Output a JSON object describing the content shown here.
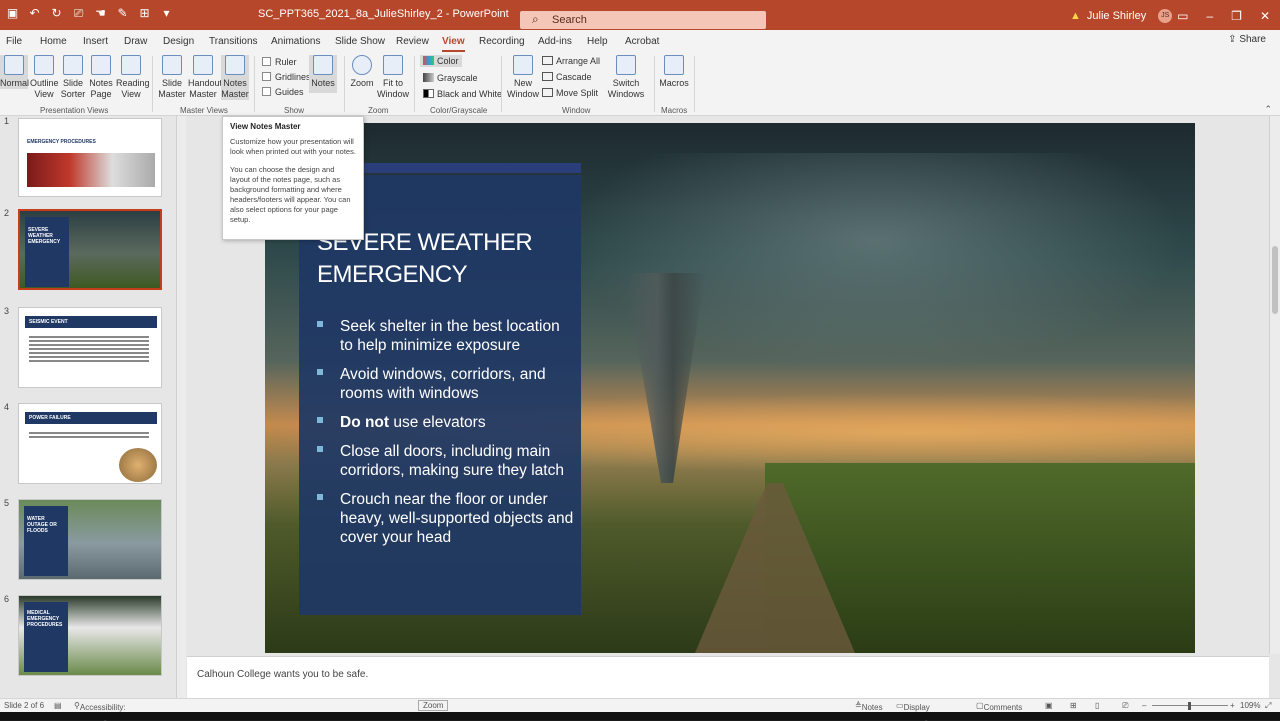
{
  "app": {
    "document_title": "SC_PPT365_2021_8a_JulieShirley_2 - PowerPoint",
    "search_placeholder": "Search",
    "user_name": "Julie Shirley",
    "user_initials": "JS"
  },
  "tabs": [
    "File",
    "Home",
    "Insert",
    "Draw",
    "Design",
    "Transitions",
    "Animations",
    "Slide Show",
    "Review",
    "View",
    "Recording",
    "Add-ins",
    "Help",
    "Acrobat"
  ],
  "active_tab": "View",
  "share_label": "Share",
  "ribbon": {
    "presentation_views": {
      "label": "Presentation Views",
      "buttons": [
        "Normal",
        "Outline View",
        "Slide Sorter",
        "Notes Page",
        "Reading View"
      ]
    },
    "master_views": {
      "label": "Master Views",
      "buttons": [
        "Slide Master",
        "Handout Master",
        "Notes Master"
      ]
    },
    "show": {
      "label": "Show",
      "checkboxes": [
        "Ruler",
        "Gridlines",
        "Guides"
      ],
      "notes_button": "Notes"
    },
    "zoom": {
      "label": "Zoom",
      "buttons": [
        "Zoom",
        "Fit to Window"
      ]
    },
    "color_grayscale": {
      "label": "Color/Grayscale",
      "options": [
        "Color",
        "Grayscale",
        "Black and White"
      ]
    },
    "window": {
      "label": "Window",
      "new_window": "New Window",
      "small": [
        "Arrange All",
        "Cascade",
        "Move Split"
      ],
      "switch_windows": "Switch Windows"
    },
    "macros": {
      "label": "Macros",
      "button": "Macros"
    }
  },
  "tooltip": {
    "title": "View Notes Master",
    "para1": "Customize how your presentation will look when printed out with your notes.",
    "para2": "You can choose the design and layout of the notes page, such as background formatting and where headers/footers will appear. You can also select options for your page setup."
  },
  "thumbnails": [
    {
      "num": "1",
      "title": "EMERGENCY PROCEDURES"
    },
    {
      "num": "2",
      "title": "SEVERE WEATHER EMERGENCY"
    },
    {
      "num": "3",
      "title": "SEISMIC EVENT"
    },
    {
      "num": "4",
      "title": "POWER FAILURE"
    },
    {
      "num": "5",
      "title": "WATER OUTAGE OR FLOODS"
    },
    {
      "num": "6",
      "title": "MEDICAL EMERGENCY PROCEDURES"
    }
  ],
  "slide": {
    "title_line1": "SEVERE WEATHER",
    "title_line2": "EMERGENCY",
    "bullets": [
      {
        "bold": "",
        "text": "Seek shelter in the best location to help minimize exposure"
      },
      {
        "bold": "",
        "text": "Avoid windows, corridors, and rooms with windows"
      },
      {
        "bold": "Do not",
        "text": " use elevators"
      },
      {
        "bold": "",
        "text": "Close all doors, including main corridors, making sure they latch"
      },
      {
        "bold": "",
        "text": "Crouch near the floor or under heavy, well-supported objects and cover your head"
      }
    ]
  },
  "notes_text": "Calhoun College wants you to be safe.",
  "status": {
    "slide_counter": "Slide 2 of 6",
    "accessibility": "Accessibility: Investigate",
    "zoom_label": "Zoom",
    "notes": "Notes",
    "display_settings": "Display Settings",
    "comments": "Comments",
    "zoom_percent": "109%"
  },
  "colors": {
    "accent": "#b7472a",
    "slide_panel": "#1f3864",
    "selection": "#c43e1c"
  }
}
